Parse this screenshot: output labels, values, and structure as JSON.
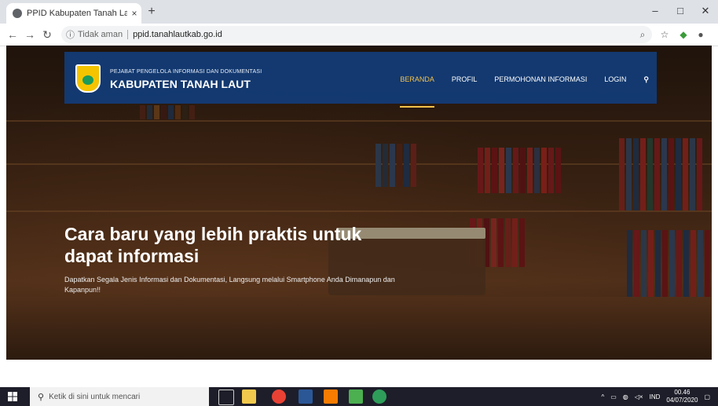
{
  "browser": {
    "tab_title": "PPID Kabupaten Tanah Laut",
    "tab_close": "×",
    "new_tab": "+",
    "address": {
      "security_label": "Tidak aman",
      "url": "ppid.tanahlautkab.go.id"
    },
    "window_controls": [
      "–",
      "□",
      "✕"
    ]
  },
  "site": {
    "brand_subtitle": "PEJABAT PENGELOLA INFORMASI DAN DOKUMENTASI",
    "brand_title": "KABUPATEN TANAH LAUT",
    "nav": [
      "BERANDA",
      "PROFIL",
      "PERMOHONAN INFORMASI",
      "LOGIN"
    ],
    "active_nav": "BERANDA",
    "hero_title": "Cara baru yang lebih praktis untuk dapat informasi",
    "hero_subtitle": "Dapatkan Segala Jenis Informasi dan Dokumentasi, Langsung melalui Smartphone Anda Dimanapun dan Kapanpun!!"
  },
  "taskbar": {
    "search_placeholder": "Ketik di sini untuk mencari",
    "language": "IND",
    "time": "00.46",
    "date": "04/07/2020"
  },
  "colors": {
    "navbar": "#123c78",
    "accent": "#f5c24a"
  }
}
